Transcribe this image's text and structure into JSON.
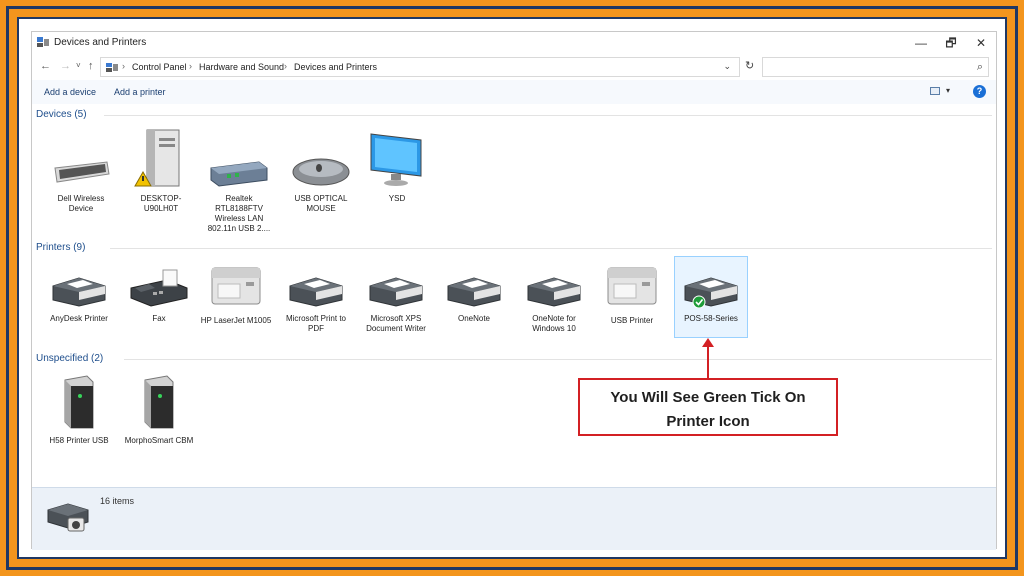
{
  "window": {
    "title": "Devices and Printers",
    "controls": {
      "minimize": "—",
      "maximize": "🗗",
      "close": "✕"
    }
  },
  "addressbar": {
    "back": "←",
    "forward": "→",
    "recent": "˅",
    "up": "↑",
    "breadcrumbs": [
      "Control Panel",
      "Hardware and Sound",
      "Devices and Printers"
    ],
    "separator": "›",
    "dropdown": "⌄",
    "refresh": "↻",
    "search_placeholder": "",
    "search_icon": "⌕"
  },
  "commandbar": {
    "add_device": "Add a device",
    "add_printer": "Add a printer",
    "view_dropdown": "▾",
    "help": "?"
  },
  "groups": {
    "devices": {
      "header": "Devices (5)",
      "items": [
        {
          "label": "Dell Wireless Device",
          "icon": "keyboard-icon"
        },
        {
          "label": "DESKTOP-U90LH0T",
          "icon": "computer-tower-icon"
        },
        {
          "label": "Realtek RTL8188FTV Wireless LAN 802.11n USB 2....",
          "icon": "network-adapter-icon"
        },
        {
          "label": "USB OPTICAL MOUSE",
          "icon": "mouse-icon"
        },
        {
          "label": "YSD",
          "icon": "monitor-icon"
        }
      ]
    },
    "printers": {
      "header": "Printers (9)",
      "items": [
        {
          "label": "AnyDesk Printer",
          "icon": "printer-icon"
        },
        {
          "label": "Fax",
          "icon": "fax-icon"
        },
        {
          "label": "HP LaserJet M1005",
          "icon": "laser-printer-icon"
        },
        {
          "label": "Microsoft Print to PDF",
          "icon": "printer-icon"
        },
        {
          "label": "Microsoft XPS Document Writer",
          "icon": "printer-icon"
        },
        {
          "label": "OneNote",
          "icon": "printer-icon"
        },
        {
          "label": "OneNote for Windows 10",
          "icon": "printer-icon"
        },
        {
          "label": "USB Printer",
          "icon": "laser-printer-icon"
        },
        {
          "label": "POS-58-Series",
          "icon": "printer-icon",
          "default": true
        }
      ]
    },
    "unspecified": {
      "header": "Unspecified (2)",
      "items": [
        {
          "label": "H58 Printer USB",
          "icon": "device-box-icon"
        },
        {
          "label": "MorphoSmart CBM",
          "icon": "device-box-icon"
        }
      ]
    }
  },
  "statusbar": {
    "count": "16 items"
  },
  "callout": {
    "line1": "You Will See Green Tick On",
    "line2": "Printer Icon"
  },
  "colors": {
    "border_orange": "#f3951d",
    "frame_navy": "#1f3864",
    "callout_red": "#d32024",
    "tick_green": "#1f9d3a"
  }
}
